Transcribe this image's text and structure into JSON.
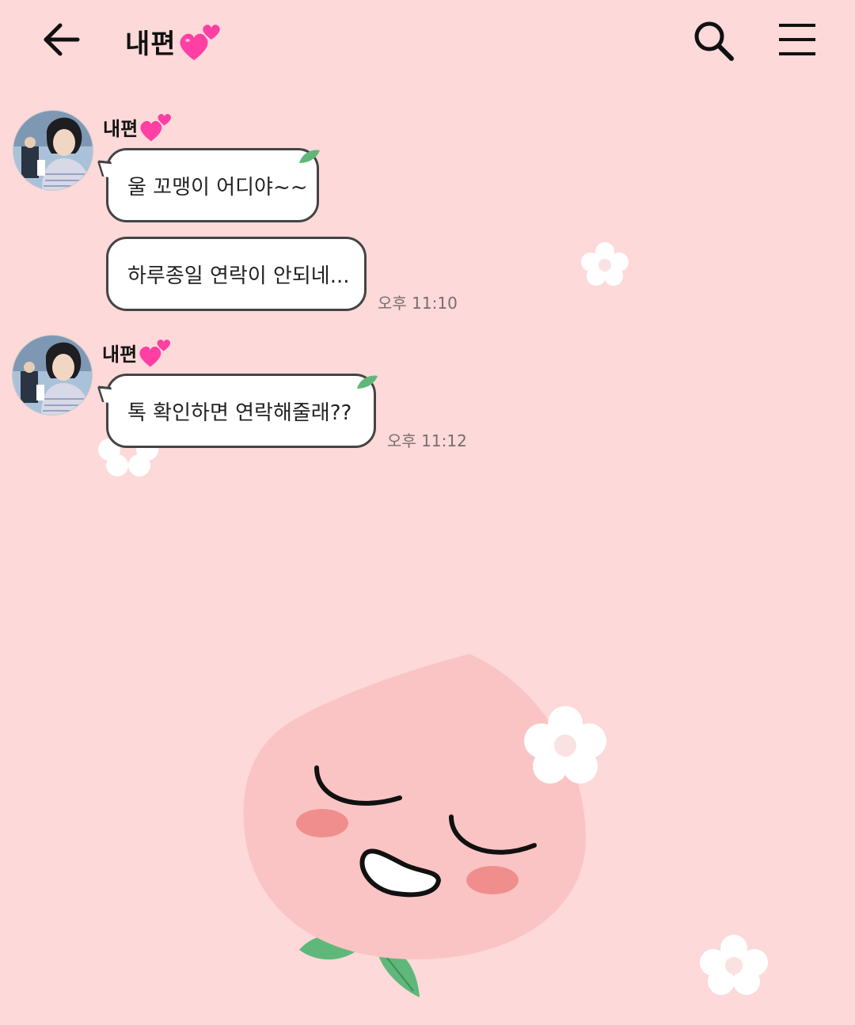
{
  "header": {
    "title": "내편",
    "back_icon": "arrow-left-icon",
    "search_icon": "search-icon",
    "menu_icon": "hamburger-menu-icon"
  },
  "messages": [
    {
      "sender": "내편",
      "lines": [
        "울 꼬맹이 어디야~~",
        "하루종일 연락이 안되네..."
      ],
      "time": "오후 11:10"
    },
    {
      "sender": "내편",
      "lines": [
        "톡 확인하면 연락해줄래??"
      ],
      "time": "오후 11:12"
    }
  ],
  "colors": {
    "background": "#fdd9d9",
    "bubble": "#ffffff",
    "bubble_border": "#444444",
    "heart": "#ff3fa4",
    "peach": "#fbc4c4",
    "leaf": "#5fb87a"
  }
}
